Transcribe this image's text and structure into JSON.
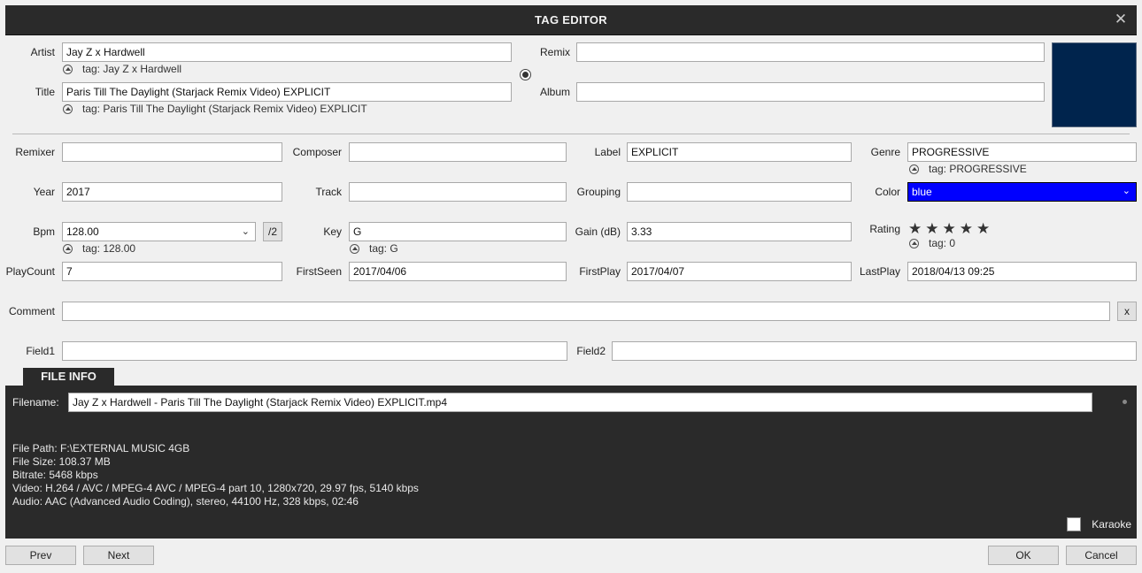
{
  "window": {
    "title": "TAG EDITOR",
    "close_glyph": "✕"
  },
  "fields": {
    "artist": {
      "label": "Artist",
      "value": "Jay Z x Hardwell",
      "tag": "tag: Jay Z x Hardwell"
    },
    "title": {
      "label": "Title",
      "value": "Paris Till The Daylight (Starjack Remix Video) EXPLICIT",
      "tag": "tag: Paris Till The Daylight (Starjack Remix Video) EXPLICIT"
    },
    "remix": {
      "label": "Remix",
      "value": ""
    },
    "album": {
      "label": "Album",
      "value": ""
    },
    "remixer": {
      "label": "Remixer",
      "value": ""
    },
    "composer": {
      "label": "Composer",
      "value": ""
    },
    "label": {
      "label": "Label",
      "value": "EXPLICIT"
    },
    "genre": {
      "label": "Genre",
      "value": "PROGRESSIVE",
      "tag": "tag: PROGRESSIVE"
    },
    "year": {
      "label": "Year",
      "value": "2017"
    },
    "track": {
      "label": "Track",
      "value": ""
    },
    "grouping": {
      "label": "Grouping",
      "value": ""
    },
    "color": {
      "label": "Color",
      "value": "blue",
      "swatch": "#0000ff"
    },
    "bpm": {
      "label": "Bpm",
      "value": "128.00",
      "tag": "tag: 128.00",
      "half_label": "/2"
    },
    "key": {
      "label": "Key",
      "value": "G",
      "tag": "tag: G"
    },
    "gain": {
      "label": "Gain (dB)",
      "value": "3.33"
    },
    "rating": {
      "label": "Rating",
      "stars": 5,
      "tag": "tag: 0"
    },
    "playcount": {
      "label": "PlayCount",
      "value": "7"
    },
    "firstseen": {
      "label": "FirstSeen",
      "value": "2017/04/06"
    },
    "firstplay": {
      "label": "FirstPlay",
      "value": "2017/04/07"
    },
    "lastplay": {
      "label": "LastPlay",
      "value": "2018/04/13 09:25"
    },
    "comment": {
      "label": "Comment",
      "value": "",
      "clear_label": "x"
    },
    "field1": {
      "label": "Field1",
      "value": ""
    },
    "field2": {
      "label": "Field2",
      "value": ""
    }
  },
  "cover": {
    "color": "#00244d"
  },
  "file_info": {
    "tab_label": "FILE INFO",
    "filename_label": "Filename:",
    "filename": "Jay Z x Hardwell - Paris Till The Daylight (Starjack Remix Video) EXPLICIT.mp4",
    "lines": [
      "File Path: F:\\EXTERNAL MUSIC 4GB",
      "File Size: 108.37 MB",
      "Bitrate: 5468 kbps",
      "Video: H.264 / AVC / MPEG-4 AVC / MPEG-4 part 10, 1280x720, 29.97 fps, 5140 kbps",
      "Audio: AAC (Advanced Audio Coding), stereo, 44100 Hz, 328 kbps, 02:46"
    ],
    "karaoke_label": "Karaoke"
  },
  "buttons": {
    "prev": "Prev",
    "next": "Next",
    "ok": "OK",
    "cancel": "Cancel"
  }
}
